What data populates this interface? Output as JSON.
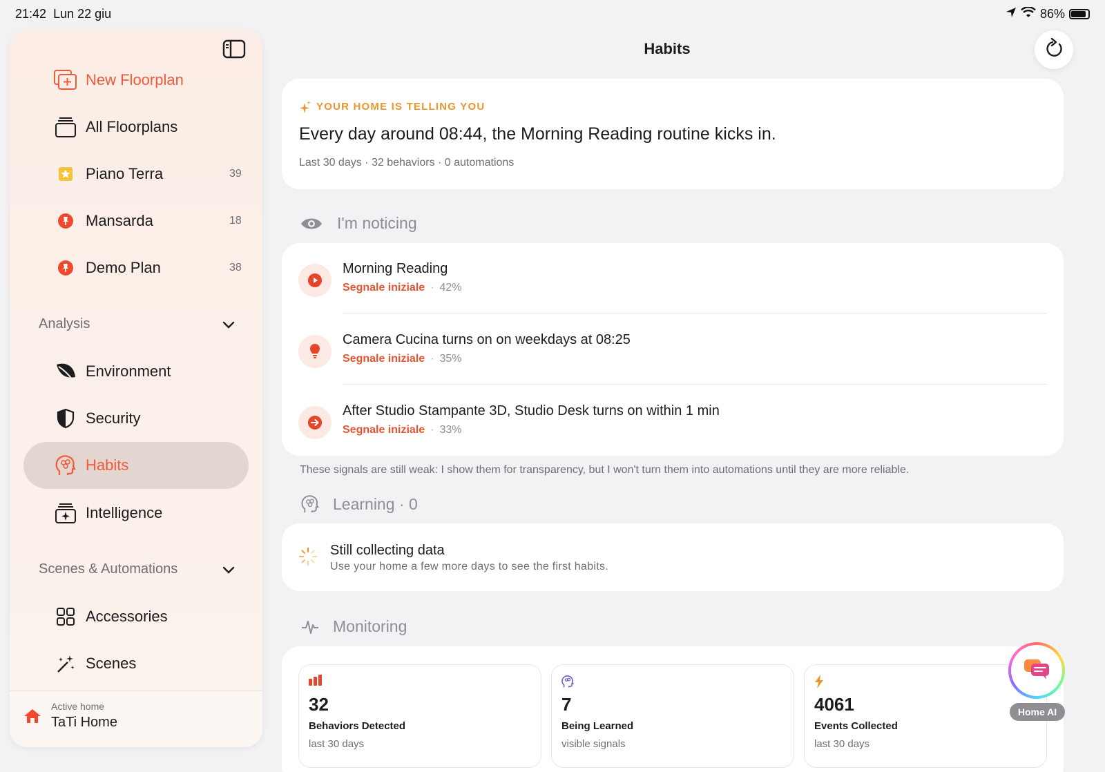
{
  "status_bar": {
    "time": "21:42",
    "date": "Lun 22 giu",
    "battery": "86%",
    "battery_level": 0.86
  },
  "sidebar": {
    "toggle_icon": "sidebar-toggle-icon",
    "floorplan_items": [
      {
        "label": "New Floorplan",
        "icon": "add-floorplan-icon"
      },
      {
        "label": "All Floorplans",
        "icon": "stack-icon"
      },
      {
        "label": "Piano Terra",
        "count": "39",
        "icon": "star-icon"
      },
      {
        "label": "Mansarda",
        "count": "18",
        "icon": "pin-icon"
      },
      {
        "label": "Demo Plan",
        "count": "38",
        "icon": "pin-icon"
      }
    ],
    "analysis_section": "Analysis",
    "analysis_items": [
      {
        "label": "Environment",
        "icon": "leaf-icon"
      },
      {
        "label": "Security",
        "icon": "shield-icon"
      },
      {
        "label": "Habits",
        "icon": "brain-head-icon",
        "active": true
      },
      {
        "label": "Intelligence",
        "icon": "sparkle-stack-icon"
      }
    ],
    "scenes_section": "Scenes & Automations",
    "scenes_items": [
      {
        "label": "Accessories",
        "icon": "grid-icon"
      },
      {
        "label": "Scenes",
        "icon": "magic-wand-icon"
      }
    ],
    "footer": {
      "label": "Active home",
      "name": "TaTi Home"
    }
  },
  "header": {
    "title": "Habits"
  },
  "hero": {
    "kicker": "YOUR HOME IS TELLING YOU",
    "headline": "Every day around 08:44, the Morning Reading routine kicks in.",
    "meta": "Last 30 days · 32 behaviors · 0 automations"
  },
  "noticing": {
    "title": "I'm noticing",
    "items": [
      {
        "title": "Morning Reading",
        "tag": "Segnale iniziale",
        "pct": "42%",
        "icon": "play-icon"
      },
      {
        "title": "Camera Cucina turns on on weekdays at 08:25",
        "tag": "Segnale iniziale",
        "pct": "35%",
        "icon": "lightbulb-icon"
      },
      {
        "title": "After Studio Stampante 3D, Studio Desk turns on within 1 min",
        "tag": "Segnale iniziale",
        "pct": "33%",
        "icon": "arrow-right-icon"
      }
    ],
    "note": "These signals are still weak: I show them for transparency, but I won't turn them into automations until they are more reliable."
  },
  "learning": {
    "title": "Learning · 0",
    "card_title": "Still collecting data",
    "card_sub": "Use your home a few more days to see the first habits."
  },
  "monitoring": {
    "title": "Monitoring",
    "tiles": [
      {
        "value": "32",
        "label": "Behaviors Detected",
        "sub": "last 30 days",
        "icon": "bar-chart-icon"
      },
      {
        "value": "7",
        "label": "Being Learned",
        "sub": "visible signals",
        "icon": "brain-head-icon"
      },
      {
        "value": "4061",
        "label": "Events Collected",
        "sub": "last 30 days",
        "icon": "bolt-icon"
      }
    ]
  },
  "ai": {
    "label": "Home AI"
  },
  "colors": {
    "accent": "#ef5b3a",
    "kicker": "#e8962b",
    "background": "#f2f2f4"
  }
}
